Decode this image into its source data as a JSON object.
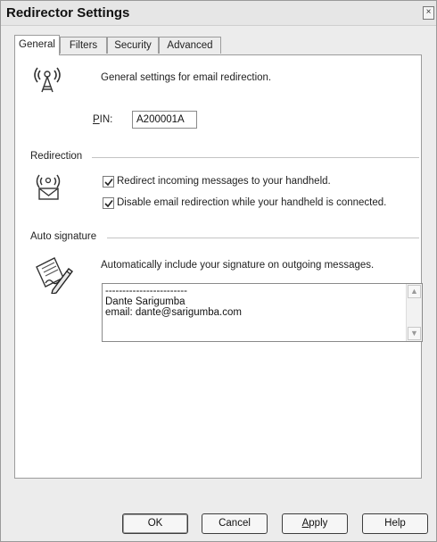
{
  "window": {
    "title": "Redirector Settings",
    "close_glyph": "×"
  },
  "tabs": [
    {
      "label": "General",
      "active": true
    },
    {
      "label": "Filters",
      "active": false
    },
    {
      "label": "Security",
      "active": false
    },
    {
      "label": "Advanced",
      "active": false
    }
  ],
  "general": {
    "description": "General settings for email redirection.",
    "pin_label": "PIN:",
    "pin_value": "A200001A"
  },
  "redirection": {
    "heading": "Redirection",
    "option1": {
      "label": "Redirect incoming messages to your handheld.",
      "checked": true
    },
    "option2": {
      "label": "Disable email redirection while your handheld is connected.",
      "checked": true
    }
  },
  "auto_signature": {
    "heading": "Auto signature",
    "description": "Automatically include your signature on outgoing messages.",
    "signature_text": "------------------------\nDante Sarigumba\nemail: dante@sarigumba.com"
  },
  "buttons": {
    "ok": "OK",
    "cancel": "Cancel",
    "apply": "Apply",
    "help": "Help"
  },
  "icons": {
    "wireless": "wireless-tower-icon",
    "redirect": "wireless-envelope-icon",
    "signature": "signature-pen-icon",
    "scroll_up": "▲",
    "scroll_down": "▼"
  }
}
